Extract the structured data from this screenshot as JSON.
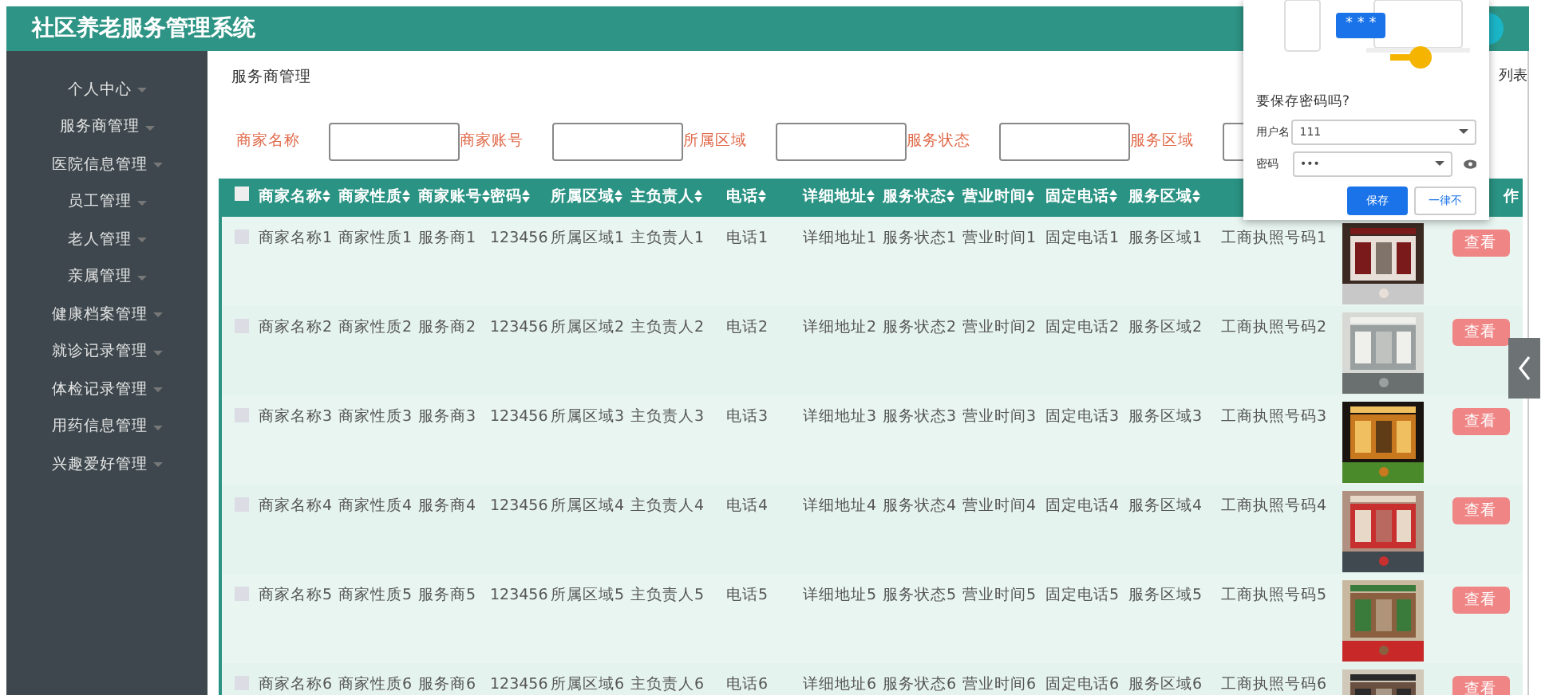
{
  "header": {
    "title": "社区养老服务管理系统"
  },
  "sidebar": {
    "items": [
      {
        "label": "个人中心"
      },
      {
        "label": "服务商管理"
      },
      {
        "label": "医院信息管理"
      },
      {
        "label": "员工管理"
      },
      {
        "label": "老人管理"
      },
      {
        "label": "亲属管理"
      },
      {
        "label": "健康档案管理"
      },
      {
        "label": "就诊记录管理"
      },
      {
        "label": "体检记录管理"
      },
      {
        "label": "用药信息管理"
      },
      {
        "label": "兴趣爱好管理"
      }
    ]
  },
  "breadcrumb": "服务商管理",
  "side_link": "列表",
  "search": {
    "fields": [
      {
        "label": "商家名称"
      },
      {
        "label": "商家账号"
      },
      {
        "label": "所属区域"
      },
      {
        "label": "服务状态"
      },
      {
        "label": "服务区域"
      }
    ]
  },
  "table": {
    "all_checked": false,
    "columns": [
      "商家名称",
      "商家性质",
      "商家账号",
      "密码",
      "所属区域",
      "主负责人",
      "电话",
      "详细地址",
      "服务状态",
      "营业时间",
      "固定电话",
      "服务区域"
    ],
    "action_column": "作",
    "rows": [
      {
        "checked": false,
        "cells": [
          "商家名称1",
          "商家性质1",
          "服务商1",
          "123456",
          "所属区域1",
          "主负责人1",
          "电话1",
          "详细地址1",
          "服务状态1",
          "营业时间1",
          "固定电话1",
          "服务区域1",
          "工商执照号码1"
        ],
        "action": "查看"
      },
      {
        "checked": false,
        "cells": [
          "商家名称2",
          "商家性质2",
          "服务商2",
          "123456",
          "所属区域2",
          "主负责人2",
          "电话2",
          "详细地址2",
          "服务状态2",
          "营业时间2",
          "固定电话2",
          "服务区域2",
          "工商执照号码2"
        ],
        "action": "查看"
      },
      {
        "checked": false,
        "cells": [
          "商家名称3",
          "商家性质3",
          "服务商3",
          "123456",
          "所属区域3",
          "主负责人3",
          "电话3",
          "详细地址3",
          "服务状态3",
          "营业时间3",
          "固定电话3",
          "服务区域3",
          "工商执照号码3"
        ],
        "action": "查看"
      },
      {
        "checked": false,
        "cells": [
          "商家名称4",
          "商家性质4",
          "服务商4",
          "123456",
          "所属区域4",
          "主负责人4",
          "电话4",
          "详细地址4",
          "服务状态4",
          "营业时间4",
          "固定电话4",
          "服务区域4",
          "工商执照号码4"
        ],
        "action": "查看"
      },
      {
        "checked": false,
        "cells": [
          "商家名称5",
          "商家性质5",
          "服务商5",
          "123456",
          "所属区域5",
          "主负责人5",
          "电话5",
          "详细地址5",
          "服务状态5",
          "营业时间5",
          "固定电话5",
          "服务区域5",
          "工商执照号码5"
        ],
        "action": "查看"
      },
      {
        "checked": false,
        "cells": [
          "商家名称6",
          "商家性质6",
          "服务商6",
          "123456",
          "所属区域6",
          "主负责人6",
          "电话6",
          "详细地址6",
          "服务状态6",
          "营业时间6",
          "固定电话6",
          "服务区域6",
          "工商执照号码6"
        ],
        "action": "查看"
      }
    ]
  },
  "password_popup": {
    "mask": "* * *",
    "title": "要保存密码吗?",
    "username_label": "用户名",
    "username": "111",
    "password_label": "密码",
    "password": "•••",
    "buttons": [
      {
        "label": "保存",
        "kind": "primary"
      },
      {
        "label": "一律不",
        "kind": "secondary"
      }
    ]
  }
}
